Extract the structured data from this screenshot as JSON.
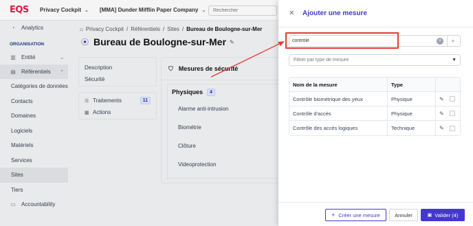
{
  "topbar": {
    "logo": "EQS",
    "app": "Privacy Cockpit",
    "company": "[MMA] Dunder Mifflin Paper Company",
    "search_placeholder": "Rechercher"
  },
  "sidebar": {
    "analytics": "Analytics",
    "section": "ORGANISATION",
    "entity": "Entité",
    "referentiels": "Référentiels",
    "sub_items": [
      "Catégories de données",
      "Contacts",
      "Domaines",
      "Logiciels",
      "Matériels",
      "Services",
      "Sites",
      "Tiers"
    ],
    "active_sub": "Sites",
    "accountability": "Accountability"
  },
  "breadcrumb": {
    "items": [
      "Privacy Cockpit",
      "Référentiels",
      "Sites"
    ],
    "current": "Bureau de Boulogne-sur-Mer"
  },
  "page": {
    "title": "Bureau de Boulogne-sur-Mer"
  },
  "tabs_left": {
    "description": "Description",
    "securite": "Sécurité",
    "traitements": "Traitements",
    "traitements_count": "11",
    "actions": "Actions"
  },
  "security": {
    "header": "Mesures de sécurité",
    "category": "Physiques",
    "category_count": "4",
    "items": [
      "Alarme anti-intrusion",
      "Biométrie",
      "Clôture",
      "Videoprotection"
    ]
  },
  "modal": {
    "title": "Ajouter une mesure",
    "search_value": "contrôle",
    "filter_placeholder": "Filtrer par type de mesure",
    "columns": {
      "name": "Nom de la mesure",
      "type": "Type"
    },
    "rows": [
      {
        "name": "Contrôle biométrique des yeux",
        "type": "Physique"
      },
      {
        "name": "Contrôle d'accès",
        "type": "Physique"
      },
      {
        "name": "Contrôle des accès logiques",
        "type": "Technique"
      }
    ],
    "create_label": "Créer une mesure",
    "cancel_label": "Annuler",
    "validate_label": "Valider (4)"
  },
  "colors": {
    "accent": "#4338ca",
    "brand": "#e11d48",
    "annotation": "#e53935"
  }
}
